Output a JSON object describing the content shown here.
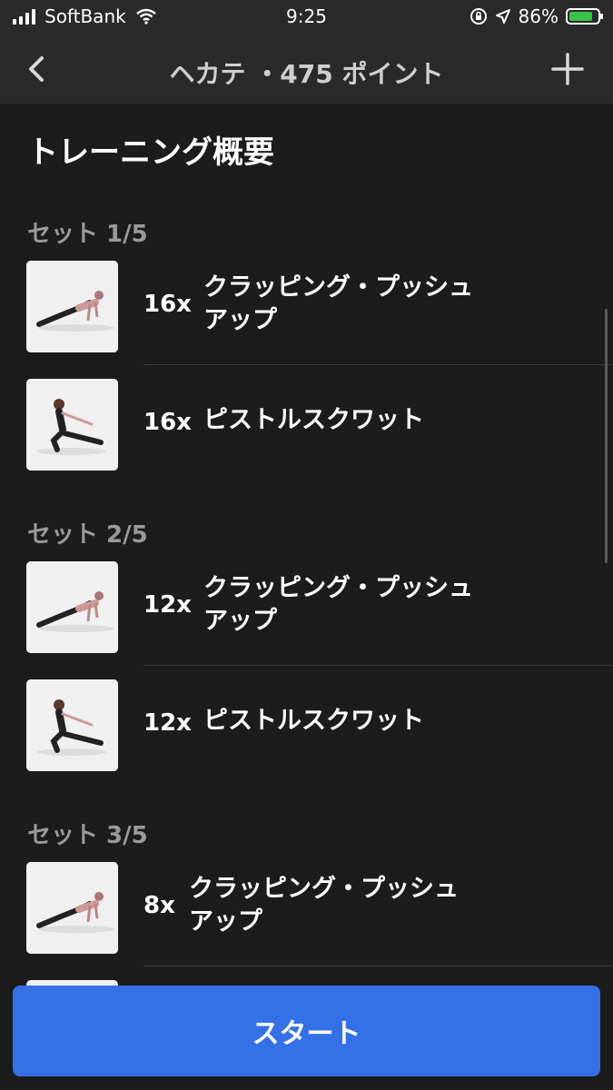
{
  "status": {
    "carrier": "SoftBank",
    "time": "9:25",
    "battery_percent": "86%",
    "battery_level": 0.86,
    "icons": [
      "signal-bars-icon",
      "wifi-icon",
      "orientation-lock-icon",
      "location-arrow-icon",
      "battery-charging-icon"
    ]
  },
  "nav": {
    "title": "ヘカテ ・475 ポイント",
    "back_icon": "chevron-left-icon",
    "add_icon": "plus-icon"
  },
  "heading": "トレーニング概要",
  "sets": [
    {
      "title": "セット 1/5",
      "exercises": [
        {
          "reps": "16x",
          "name_line1": "クラッピング・プッシュ",
          "name_line2": "アップ",
          "image": "clapping-pushup-image"
        },
        {
          "reps": "16x",
          "name_line1": "ピストルスクワット",
          "name_line2": "",
          "image": "pistol-squat-image"
        }
      ]
    },
    {
      "title": "セット 2/5",
      "exercises": [
        {
          "reps": "12x",
          "name_line1": "クラッピング・プッシュ",
          "name_line2": "アップ",
          "image": "clapping-pushup-image"
        },
        {
          "reps": "12x",
          "name_line1": "ピストルスクワット",
          "name_line2": "",
          "image": "pistol-squat-image"
        }
      ]
    },
    {
      "title": "セット 3/5",
      "exercises": [
        {
          "reps": "8x",
          "name_line1": "クラッピング・プッシュ",
          "name_line2": "アップ",
          "image": "clapping-pushup-image"
        }
      ]
    }
  ],
  "start_label": "スタート",
  "colors": {
    "background": "#1c1c1c",
    "bar": "#2a2a2a",
    "accent": "#3470e6",
    "muted": "#9a9a9a",
    "battery": "#39c14a"
  }
}
